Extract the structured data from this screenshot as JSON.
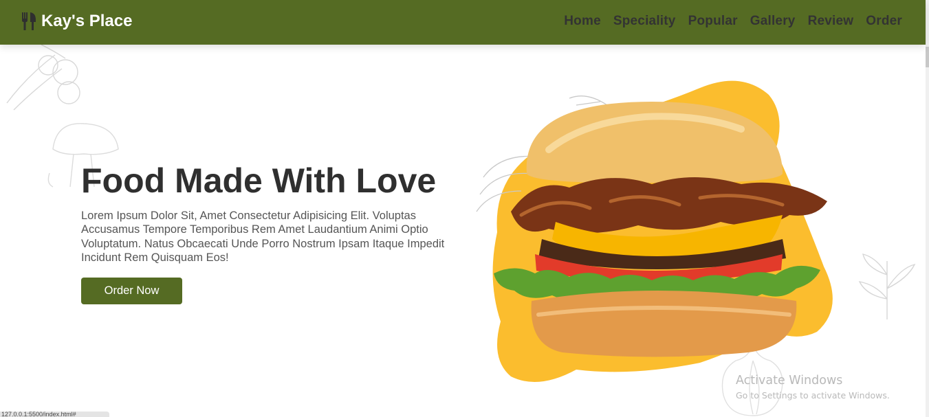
{
  "header": {
    "logo_text": "Kay's Place",
    "logo_icon": "utensils-icon",
    "nav_items": [
      "Home",
      "Speciality",
      "Popular",
      "Gallery",
      "Review",
      "Order"
    ]
  },
  "hero": {
    "title": "Food Made With Love",
    "description": "Lorem Ipsum Dolor Sit, Amet Consectetur Adipisicing Elit. Voluptas Accusamus Tempore Temporibus Rem Amet Laudantium Animi Optio Voluptatum. Natus Obcaecati Unde Porro Nostrum Ipsam Itaque Impedit Incidunt Rem Quisquam Eos!",
    "button_label": "Order Now",
    "image_icon": "burger-image"
  },
  "watermark": {
    "title": "Activate Windows",
    "subtitle": "Go to Settings to activate Windows."
  },
  "status_bar": {
    "url": "127.0.0.1:5500/index.html#"
  },
  "colors": {
    "brand_green": "#556b23",
    "accent_yellow": "#fbbd2e",
    "heading": "#2f2f2f",
    "nav_text": "#333333"
  }
}
